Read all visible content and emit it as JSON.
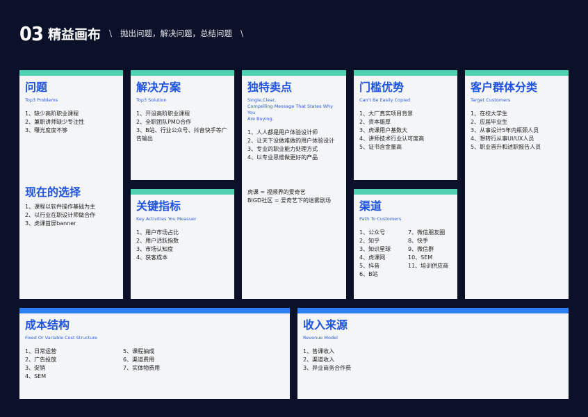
{
  "header": {
    "number": "03",
    "title": "精益画布",
    "slash": "\\",
    "subtitle": "抛出问题，解决问题，总结问题"
  },
  "colors": {
    "background": "#0a1129",
    "card": "#f4f5f7",
    "teal_bar": "#4fd1b2",
    "blue_bar": "#2f7ff5",
    "heading": "#1f54e0"
  },
  "problem": {
    "title": "问题",
    "en": "Top3 Problems",
    "items": [
      "1、缺少高阶职业课程",
      "2、兼职讲师缺少专注性",
      "3、曝光度度不够"
    ]
  },
  "alternatives": {
    "title": "现在的选择",
    "items": [
      "1、课程以软件操作基础为主",
      "2、以行业在职设计师做合作",
      "3、虎课首屏banner"
    ]
  },
  "solution": {
    "title": "解决方案",
    "en": "Top3 Solution",
    "items": [
      "1、开设高阶职业课程",
      "2、全职团队PMO合作",
      "3、B站、行业公众号、抖音快手等广",
      "告输出"
    ]
  },
  "metrics": {
    "title": "关键指标",
    "en": "Key Activities You Measuer",
    "items": [
      "1、用户市场占比",
      "2、用户活跃指数",
      "3、市场认知度",
      "4、获客成本"
    ]
  },
  "uvp": {
    "title": "独特卖点",
    "en_lines": [
      "Single,Clear,",
      "Compelling Message That States Why You",
      "Are Buying."
    ],
    "items": [
      "1、人人都是用户体验设计师",
      "2、让天下没做难做的用户体验设计",
      "3、专业的职业能力处理方式",
      "4、以专业思维做更好的产品"
    ],
    "notes": [
      "虎课 = 视频界的爱奇艺",
      "BIGD社区 = 爱奇艺下的迷雾剧场"
    ]
  },
  "advantage": {
    "title": "门槛优势",
    "en": "Can't Be Easily Copied",
    "items": [
      "1、大厂真实项目背景",
      "2、资本雄厚",
      "3、虎课用户基数大",
      "4、讲师技术行业认可度高",
      "5、证书含金量高"
    ]
  },
  "channels": {
    "title": "渠道",
    "en": "Path To Customers",
    "left": [
      "1、公众号",
      "2、知乎",
      "3、知识星球",
      "4、虎课网",
      "5、抖音",
      "6、B站"
    ],
    "right": [
      "7、微信朋友圈",
      "8、快手",
      "9、微信群",
      "10、SEM",
      "11、培训供应商"
    ]
  },
  "segments": {
    "title": "客户群体分类",
    "en": "Target Customers",
    "items": [
      "1、在校大学生",
      "2、应届毕业生",
      "3、从事设计5年内瓶颈人员",
      "4、想转行从事UI/UX人员",
      "5、职业晋升和述职报告人员"
    ]
  },
  "cost": {
    "title": "成本结构",
    "en": "Fixed Or Variable Cost Structure",
    "left": [
      "1、日常运营",
      "2、广告投放",
      "3、促销",
      "4、SEM"
    ],
    "right": [
      "5、课程抽成",
      "6、渠道费用",
      "7、实体物费用"
    ]
  },
  "revenue": {
    "title": "收入来源",
    "en": "Revenue Model",
    "items": [
      "1、售课收入",
      "2、渠道收入",
      "3、异业商务合作费"
    ]
  }
}
